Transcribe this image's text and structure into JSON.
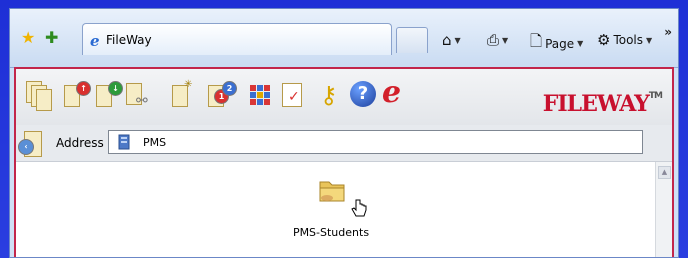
{
  "browser": {
    "tab_title": "FileWay",
    "commands": {
      "page_label": "Page",
      "tools_label": "Tools"
    },
    "more_chevron": "»"
  },
  "app": {
    "logo_first": "F",
    "logo_rest": "ILEWAY",
    "logo_tm": "TM",
    "address_label": "Address",
    "address_value": "PMS",
    "folders": [
      {
        "label": "PMS-Students"
      }
    ]
  },
  "colors": {
    "desktop_bg": "#2236d8",
    "app_border": "#c2264b",
    "brand_red": "#c8102e"
  }
}
